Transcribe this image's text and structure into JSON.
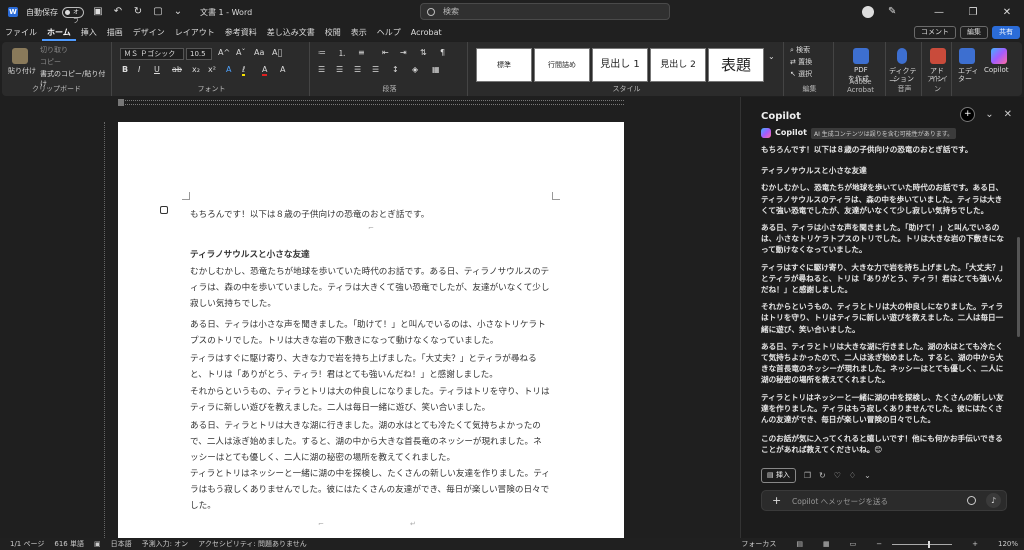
{
  "titlebar": {
    "autosave_label": "自動保存",
    "autosave_state": "オフ",
    "doc_title": "文書 1 - Word",
    "search_placeholder": "検索"
  },
  "menu": {
    "tabs": [
      "ファイル",
      "ホーム",
      "挿入",
      "描画",
      "デザイン",
      "レイアウト",
      "参考資料",
      "差し込み文書",
      "校閲",
      "表示",
      "ヘルプ",
      "Acrobat"
    ],
    "active_tab": "ホーム",
    "comment": "コメント",
    "edit": "編集",
    "share": "共有"
  },
  "ribbon": {
    "clipboard": {
      "paste": "貼り付け",
      "cut": "切り取り",
      "copy": "コピー",
      "format_painter": "書式のコピー/貼り付け",
      "label": "クリップボード"
    },
    "font": {
      "name": "ＭＳ Ｐゴシック",
      "size": "10.5",
      "label": "フォント"
    },
    "paragraph": {
      "label": "段落"
    },
    "styles": {
      "items": [
        "標準",
        "行間詰め",
        "見出し 1",
        "見出し 2",
        "表題"
      ],
      "label": "スタイル"
    },
    "editing": {
      "find": "検索",
      "replace": "置換",
      "select": "選択",
      "label": "編集"
    },
    "acrobat": {
      "pdf": "PDF",
      "create": "を作成",
      "label": "Adobe Acrobat"
    },
    "voice": {
      "dictation": "ディクテー",
      "dictation2": "ション",
      "label": "音声"
    },
    "addins": {
      "addin": "アド",
      "addin2": "イン",
      "label": "アドイン"
    },
    "editor": {
      "label": "エディ",
      "label2": "ター"
    },
    "copilot": {
      "label": "Copilot"
    }
  },
  "document": {
    "intro": "もちろんです！以下は８歳の子供向けの恐竜のおとぎ話です。",
    "title": "ティラノサウルスと小さな友達",
    "paragraphs": [
      "むかしむかし、恐竜たちが地球を歩いていた時代のお話です。ある日、ティラノサウルスのティラは、森の中を歩いていました。ティラは大きくて強い恐竜でしたが、友達がいなくて少し寂しい気持ちでした。",
      "ある日、ティラは小さな声を聞きました。「助けて！」と叫んでいるのは、小さなトリケラトプスのトリでした。トリは大きな岩の下敷きになって動けなくなっていました。",
      "ティラはすぐに駆け寄り、大きな力で岩を持ち上げました。「大丈夫？」とティラが尋ねると、トリは「ありがとう、ティラ！君はとても強いんだね！」と感謝しました。",
      "それからというもの、ティラとトリは大の仲良しになりました。ティラはトリを守り、トリはティラに新しい遊びを教えました。二人は毎日一緒に遊び、笑い合いました。",
      "ある日、ティラとトリは大きな湖に行きました。湖の水はとても冷たくて気持ちよかったので、二人は泳ぎ始めました。すると、湖の中から大きな首長竜のネッシーが現れました。ネッシーはとても優しく、二人に湖の秘密の場所を教えてくれました。",
      "ティラとトリはネッシーと一緒に湖の中を探検し、たくさんの新しい友達を作りました。ティラはもう寂しくありませんでした。彼にはたくさんの友達ができ、毎日が楽しい冒険の日々でした。"
    ]
  },
  "copilot": {
    "header": "Copilot",
    "name": "Copilot",
    "badge": "AI 生成コンテンツは誤りを含む可能性があります。",
    "intro": "もちろんです！以下は８歳の子供向けの恐竜のおとぎ話です。",
    "title": "ティラノサウルスと小さな友達",
    "paragraphs": [
      "むかしむかし、恐竜たちが地球を歩いていた時代のお話です。ある日、ティラノサウルスのティラは、森の中を歩いていました。ティラは大きくて強い恐竜でしたが、友達がいなくて少し寂しい気持ちでした。",
      "ある日、ティラは小さな声を聞きました。「助けて！」と叫んでいるのは、小さなトリケラトプスのトリでした。トリは大きな岩の下敷きになって動けなくなっていました。",
      "ティラはすぐに駆け寄り、大きな力で岩を持ち上げました。「大丈夫？」とティラが尋ねると、トリは「ありがとう、ティラ！君はとても強いんだね！」と感謝しました。",
      "それからというもの、ティラとトリは大の仲良しになりました。ティラはトリを守り、トリはティラに新しい遊びを教えました。二人は毎日一緒に遊び、笑い合いました。",
      "ある日、ティラとトリは大きな湖に行きました。湖の水はとても冷たくて気持ちよかったので、二人は泳ぎ始めました。すると、湖の中から大きな首長竜のネッシーが現れました。ネッシーはとても優しく、二人に湖の秘密の場所を教えてくれました。",
      "ティラとトリはネッシーと一緒に湖の中を探検し、たくさんの新しい友達を作りました。ティラはもう寂しくありませんでした。彼にはたくさんの友達ができ、毎日が楽しい冒険の日々でした。"
    ],
    "closing": "このお話が気に入ってくれると嬉しいです！他にも何かお手伝いできることがあれば教えてくださいね。😊",
    "insert": "挿入",
    "input_placeholder": "Copilot へメッセージを送る"
  },
  "status": {
    "page": "1/1 ページ",
    "words": "616 単語",
    "lang": "日本語",
    "predict": "予測入力: オン",
    "access": "アクセシビリティ: 問題ありません",
    "focus": "フォーカス",
    "zoom": "120%"
  },
  "colors": {
    "accent": "#4f9bff",
    "share": "#2b6cd8"
  }
}
